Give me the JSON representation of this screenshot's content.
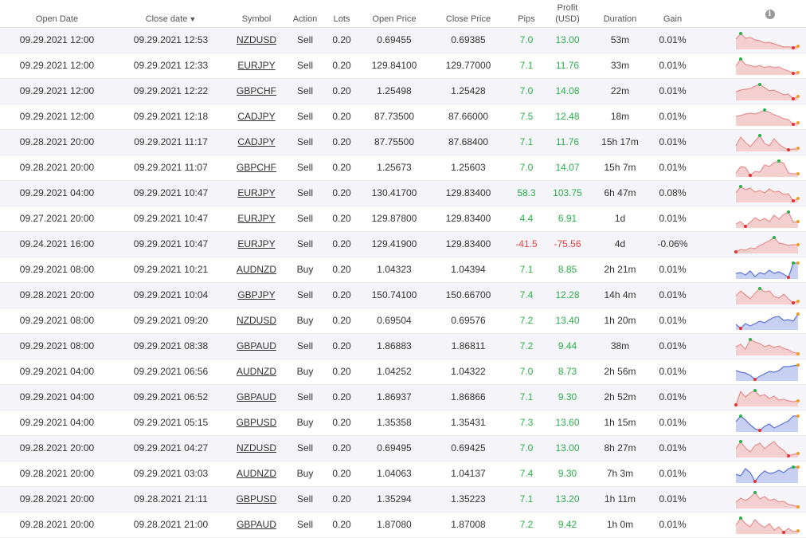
{
  "header": {
    "open_date": "Open Date",
    "close_date": "Close date",
    "close_date_sort": "▼",
    "symbol": "Symbol",
    "action": "Action",
    "lots": "Lots",
    "open_price": "Open Price",
    "close_price": "Close Price",
    "pips": "Pips",
    "profit_line1": "Profit",
    "profit_line2": "(USD)",
    "duration": "Duration",
    "gain": "Gain",
    "info_icon": "i"
  },
  "colors": {
    "positive": "#2ab04a",
    "negative": "#e74343",
    "sell_line": "#e8908f",
    "sell_fill": "#f3d0cf",
    "buy_line": "#5b73e0",
    "buy_fill": "#c7cff3",
    "marker_green": "#2ab04a",
    "marker_red": "#e53030",
    "marker_orange": "#f0a030"
  },
  "trades": [
    {
      "open_date": "09.29.2021 12:00",
      "close_date": "09.29.2021 12:53",
      "symbol": "NZDUSD",
      "action": "Sell",
      "lots": "0.20",
      "open_price": "0.69455",
      "close_price": "0.69385",
      "pips": "7.0",
      "profit": "13.00",
      "duration": "53m",
      "gain": "0.01%",
      "spark": [
        0.6,
        0.95,
        0.65,
        0.7,
        0.55,
        0.5,
        0.35,
        0.4,
        0.3,
        0.2,
        0.1,
        0.12,
        0.05,
        0.15
      ]
    },
    {
      "open_date": "09.29.2021 12:00",
      "close_date": "09.29.2021 12:33",
      "symbol": "EURJPY",
      "action": "Sell",
      "lots": "0.20",
      "open_price": "129.84100",
      "close_price": "129.77000",
      "pips": "7.1",
      "profit": "11.76",
      "duration": "33m",
      "gain": "0.01%",
      "spark": [
        0.5,
        0.95,
        0.6,
        0.55,
        0.45,
        0.55,
        0.4,
        0.5,
        0.4,
        0.45,
        0.3,
        0.2,
        0.05,
        0.1
      ]
    },
    {
      "open_date": "09.29.2021 12:00",
      "close_date": "09.29.2021 12:22",
      "symbol": "GBPCHF",
      "action": "Sell",
      "lots": "0.20",
      "open_price": "1.25498",
      "close_price": "1.25428",
      "pips": "7.0",
      "profit": "14.08",
      "duration": "22m",
      "gain": "0.01%",
      "spark": [
        0.5,
        0.6,
        0.65,
        0.7,
        0.85,
        0.95,
        0.75,
        0.55,
        0.6,
        0.45,
        0.3,
        0.35,
        0.05,
        0.2
      ]
    },
    {
      "open_date": "09.29.2021 12:00",
      "close_date": "09.29.2021 12:18",
      "symbol": "CADJPY",
      "action": "Sell",
      "lots": "0.20",
      "open_price": "87.73500",
      "close_price": "87.66000",
      "pips": "7.5",
      "profit": "12.48",
      "duration": "18m",
      "gain": "0.01%",
      "spark": [
        0.55,
        0.6,
        0.7,
        0.75,
        0.7,
        0.8,
        0.95,
        0.8,
        0.65,
        0.55,
        0.4,
        0.35,
        0.05,
        0.15
      ]
    },
    {
      "open_date": "09.28.2021 20:00",
      "close_date": "09.29.2021 11:17",
      "symbol": "CADJPY",
      "action": "Sell",
      "lots": "0.20",
      "open_price": "87.75500",
      "close_price": "87.68400",
      "pips": "7.1",
      "profit": "11.76",
      "duration": "15h 17m",
      "gain": "0.01%",
      "spark": [
        0.3,
        0.85,
        0.5,
        0.25,
        0.6,
        0.95,
        0.45,
        0.3,
        0.75,
        0.4,
        0.2,
        0.05,
        0.1,
        0.15
      ]
    },
    {
      "open_date": "09.28.2021 20:00",
      "close_date": "09.29.2021 11:07",
      "symbol": "GBPCHF",
      "action": "Sell",
      "lots": "0.20",
      "open_price": "1.25673",
      "close_price": "1.25603",
      "pips": "7.0",
      "profit": "14.07",
      "duration": "15h 7m",
      "gain": "0.01%",
      "spark": [
        0.2,
        0.6,
        0.55,
        0.05,
        0.3,
        0.25,
        0.7,
        0.6,
        0.85,
        0.95,
        0.8,
        0.2,
        0.15,
        0.15
      ]
    },
    {
      "open_date": "09.29.2021 04:00",
      "close_date": "09.29.2021 10:47",
      "symbol": "EURJPY",
      "action": "Sell",
      "lots": "0.20",
      "open_price": "130.41700",
      "close_price": "129.83400",
      "pips": "58.3",
      "profit": "103.75",
      "duration": "6h 47m",
      "gain": "0.08%",
      "spark": [
        0.55,
        0.95,
        0.75,
        0.85,
        0.6,
        0.7,
        0.55,
        0.8,
        0.6,
        0.65,
        0.45,
        0.5,
        0.05,
        0.2
      ]
    },
    {
      "open_date": "09.27.2021 20:00",
      "close_date": "09.29.2021 10:47",
      "symbol": "EURJPY",
      "action": "Sell",
      "lots": "0.20",
      "open_price": "129.87800",
      "close_price": "129.83400",
      "pips": "4.4",
      "profit": "6.91",
      "duration": "1d",
      "gain": "0.01%",
      "spark": [
        0.2,
        0.35,
        0.05,
        0.3,
        0.6,
        0.4,
        0.55,
        0.35,
        0.75,
        0.5,
        0.8,
        0.95,
        0.3,
        0.35
      ]
    },
    {
      "open_date": "09.24.2021 16:00",
      "close_date": "09.29.2021 10:47",
      "symbol": "EURJPY",
      "action": "Sell",
      "lots": "0.20",
      "open_price": "129.41900",
      "close_price": "129.83400",
      "pips": "-41.5",
      "profit": "-75.56",
      "duration": "4d",
      "gain": "-0.06%",
      "spark": [
        0.05,
        0.2,
        0.15,
        0.3,
        0.25,
        0.45,
        0.6,
        0.75,
        0.95,
        0.6,
        0.55,
        0.45,
        0.5,
        0.5
      ]
    },
    {
      "open_date": "09.29.2021 08:00",
      "close_date": "09.29.2021 10:21",
      "symbol": "AUDNZD",
      "action": "Buy",
      "lots": "0.20",
      "open_price": "1.04323",
      "close_price": "1.04394",
      "pips": "7.1",
      "profit": "8.85",
      "duration": "2h 21m",
      "gain": "0.01%",
      "spark": [
        0.3,
        0.35,
        0.2,
        0.45,
        0.1,
        0.35,
        0.25,
        0.5,
        0.3,
        0.4,
        0.25,
        0.05,
        0.95,
        0.95
      ]
    },
    {
      "open_date": "09.28.2021 20:00",
      "close_date": "09.29.2021 10:04",
      "symbol": "GBPJPY",
      "action": "Sell",
      "lots": "0.20",
      "open_price": "150.74100",
      "close_price": "150.66700",
      "pips": "7.4",
      "profit": "12.28",
      "duration": "14h 4m",
      "gain": "0.01%",
      "spark": [
        0.5,
        0.8,
        0.55,
        0.3,
        0.65,
        0.95,
        0.75,
        0.8,
        0.45,
        0.35,
        0.6,
        0.3,
        0.05,
        0.15
      ]
    },
    {
      "open_date": "09.29.2021 08:00",
      "close_date": "09.29.2021 09:20",
      "symbol": "NZDUSD",
      "action": "Buy",
      "lots": "0.20",
      "open_price": "0.69504",
      "close_price": "0.69576",
      "pips": "7.2",
      "profit": "13.40",
      "duration": "1h 20m",
      "gain": "0.01%",
      "spark": [
        0.3,
        0.05,
        0.35,
        0.2,
        0.35,
        0.5,
        0.4,
        0.6,
        0.75,
        0.8,
        0.55,
        0.6,
        0.5,
        0.95
      ]
    },
    {
      "open_date": "09.29.2021 08:00",
      "close_date": "09.29.2021 08:38",
      "symbol": "GBPAUD",
      "action": "Sell",
      "lots": "0.20",
      "open_price": "1.86883",
      "close_price": "1.86811",
      "pips": "7.2",
      "profit": "9.44",
      "duration": "38m",
      "gain": "0.01%",
      "spark": [
        0.5,
        0.65,
        0.35,
        0.95,
        0.8,
        0.7,
        0.5,
        0.6,
        0.45,
        0.55,
        0.4,
        0.3,
        0.15,
        0.05
      ]
    },
    {
      "open_date": "09.29.2021 04:00",
      "close_date": "09.29.2021 06:56",
      "symbol": "AUDNZD",
      "action": "Buy",
      "lots": "0.20",
      "open_price": "1.04252",
      "close_price": "1.04322",
      "pips": "7.0",
      "profit": "8.73",
      "duration": "2h 56m",
      "gain": "0.01%",
      "spark": [
        0.6,
        0.5,
        0.45,
        0.3,
        0.05,
        0.25,
        0.4,
        0.55,
        0.5,
        0.6,
        0.85,
        0.85,
        0.9,
        0.95
      ]
    },
    {
      "open_date": "09.29.2021 04:00",
      "close_date": "09.29.2021 06:52",
      "symbol": "GBPAUD",
      "action": "Sell",
      "lots": "0.20",
      "open_price": "1.86937",
      "close_price": "1.86866",
      "pips": "7.1",
      "profit": "9.30",
      "duration": "2h 52m",
      "gain": "0.01%",
      "spark": [
        0.05,
        0.9,
        0.55,
        0.8,
        0.95,
        0.6,
        0.7,
        0.45,
        0.6,
        0.35,
        0.4,
        0.3,
        0.25,
        0.3
      ]
    },
    {
      "open_date": "09.29.2021 04:00",
      "close_date": "09.29.2021 05:15",
      "symbol": "GBPUSD",
      "action": "Buy",
      "lots": "0.20",
      "open_price": "1.35358",
      "close_price": "1.35431",
      "pips": "7.3",
      "profit": "13.60",
      "duration": "1h 15m",
      "gain": "0.01%",
      "spark": [
        0.6,
        0.95,
        0.7,
        0.4,
        0.15,
        0.05,
        0.3,
        0.45,
        0.2,
        0.35,
        0.5,
        0.65,
        0.95,
        0.95
      ]
    },
    {
      "open_date": "09.28.2021 20:00",
      "close_date": "09.29.2021 04:27",
      "symbol": "NZDUSD",
      "action": "Sell",
      "lots": "0.20",
      "open_price": "0.69495",
      "close_price": "0.69425",
      "pips": "7.0",
      "profit": "13.00",
      "duration": "8h 27m",
      "gain": "0.01%",
      "spark": [
        0.5,
        0.95,
        0.55,
        0.3,
        0.7,
        0.85,
        0.5,
        0.75,
        0.95,
        0.6,
        0.4,
        0.05,
        0.15,
        0.2
      ]
    },
    {
      "open_date": "09.28.2021 20:00",
      "close_date": "09.29.2021 03:03",
      "symbol": "AUDNZD",
      "action": "Buy",
      "lots": "0.20",
      "open_price": "1.04063",
      "close_price": "1.04137",
      "pips": "7.4",
      "profit": "9.30",
      "duration": "7h 3m",
      "gain": "0.01%",
      "spark": [
        0.5,
        0.4,
        0.85,
        0.6,
        0.05,
        0.45,
        0.7,
        0.55,
        0.6,
        0.75,
        0.6,
        0.85,
        0.95,
        0.95
      ]
    },
    {
      "open_date": "09.28.2021 20:00",
      "close_date": "09.28.2021 21:11",
      "symbol": "GBPUSD",
      "action": "Sell",
      "lots": "0.20",
      "open_price": "1.35294",
      "close_price": "1.35223",
      "pips": "7.1",
      "profit": "13.20",
      "duration": "1h 11m",
      "gain": "0.01%",
      "spark": [
        0.35,
        0.6,
        0.45,
        0.65,
        0.95,
        0.55,
        0.7,
        0.45,
        0.55,
        0.35,
        0.4,
        0.2,
        0.15,
        0.05
      ]
    },
    {
      "open_date": "09.28.2021 20:00",
      "close_date": "09.28.2021 21:00",
      "symbol": "GBPAUD",
      "action": "Sell",
      "lots": "0.20",
      "open_price": "1.87080",
      "close_price": "1.87008",
      "pips": "7.2",
      "profit": "9.42",
      "duration": "1h 0m",
      "gain": "0.01%",
      "spark": [
        0.5,
        0.95,
        0.6,
        0.4,
        0.85,
        0.55,
        0.35,
        0.6,
        0.2,
        0.4,
        0.05,
        0.3,
        0.1,
        0.15
      ]
    }
  ]
}
